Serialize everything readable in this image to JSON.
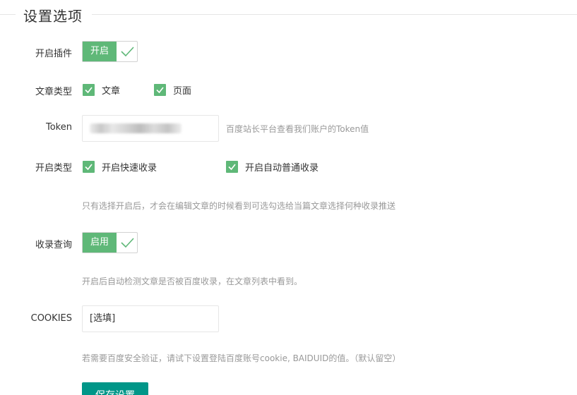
{
  "section": {
    "title": "设置选项"
  },
  "plugin_switch": {
    "label": "开启插件",
    "state_text": "开启"
  },
  "article_type": {
    "label": "文章类型",
    "options": [
      {
        "text": "文章",
        "checked": true
      },
      {
        "text": "页面",
        "checked": true
      }
    ]
  },
  "token": {
    "label": "Token",
    "aux_text": "百度站长平台查看我们账户的Token值"
  },
  "submit_type": {
    "label": "开启类型",
    "options": [
      {
        "text": "开启快速收录",
        "checked": true
      },
      {
        "text": "开启自动普通收录",
        "checked": true
      }
    ],
    "help": "只有选择开启后，才会在编辑文章的时候看到可选勾选给当篇文章选择何种收录推送"
  },
  "index_query": {
    "label": "收录查询",
    "state_text": "启用",
    "help": "开启后自动检测文章是否被百度收录，在文章列表中看到。"
  },
  "cookies": {
    "label": "COOKIES",
    "value": "[选填]",
    "help": "若需要百度安全验证，请试下设置登陆百度账号cookie, BAIDUID的值。（默认留空）"
  },
  "save_button": {
    "label": "保存设置"
  },
  "colors": {
    "accent": "#5fb878",
    "button": "#009688"
  }
}
